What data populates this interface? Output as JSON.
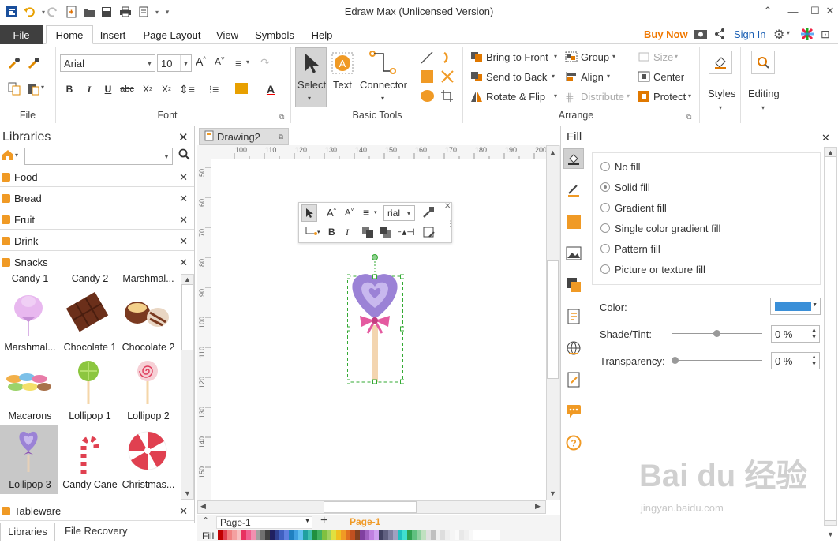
{
  "window": {
    "title": "Edraw Max (Unlicensed Version)"
  },
  "ribbon_tabs": {
    "file": "File",
    "home": "Home",
    "insert": "Insert",
    "page_layout": "Page Layout",
    "view": "View",
    "symbols": "Symbols",
    "help": "Help"
  },
  "account": {
    "buy_now": "Buy Now",
    "sign_in": "Sign In"
  },
  "font_group": {
    "font_name": "Arial",
    "font_size": "10",
    "label": "Font"
  },
  "file_group": {
    "label": "File"
  },
  "basic_tools": {
    "select": "Select",
    "text": "Text",
    "connector": "Connector",
    "label": "Basic Tools"
  },
  "arrange": {
    "bring_to_front": "Bring to Front",
    "send_to_back": "Send to Back",
    "rotate_flip": "Rotate & Flip",
    "group": "Group",
    "align": "Align",
    "distribute": "Distribute",
    "size": "Size",
    "center": "Center",
    "protect": "Protect",
    "label": "Arrange"
  },
  "styles": {
    "label": "Styles"
  },
  "editing": {
    "label": "Editing"
  },
  "libraries": {
    "title": "Libraries",
    "search_placeholder": "",
    "categories": [
      "Food",
      "Bread",
      "Fruit",
      "Drink",
      "Snacks"
    ],
    "tableware": "Tableware",
    "symbols": [
      {
        "label": "Candy 1"
      },
      {
        "label": "Candy 2"
      },
      {
        "label": "Marshmal..."
      },
      {
        "label": "Marshmal..."
      },
      {
        "label": "Chocolate 1"
      },
      {
        "label": "Chocolate 2"
      },
      {
        "label": "Macarons"
      },
      {
        "label": "Lollipop 1"
      },
      {
        "label": "Lollipop 2"
      },
      {
        "label": "Lollipop 3"
      },
      {
        "label": "Candy Cane"
      },
      {
        "label": "Christmas..."
      }
    ],
    "bottom_tabs": {
      "libraries": "Libraries",
      "file_recovery": "File Recovery"
    }
  },
  "document": {
    "tab": "Drawing2",
    "page_selector": "Page-1",
    "page_tab": "Page-1",
    "fill_label": "Fill"
  },
  "ruler": {
    "h": [
      "100",
      "110",
      "120",
      "130",
      "140",
      "150",
      "160",
      "170",
      "180",
      "190",
      "200"
    ],
    "v": [
      "50",
      "60",
      "70",
      "80",
      "90",
      "100",
      "110",
      "120",
      "130",
      "140",
      "150"
    ]
  },
  "float_toolbar": {
    "font": "rial"
  },
  "fill_panel": {
    "title": "Fill",
    "options": [
      "No fill",
      "Solid fill",
      "Gradient fill",
      "Single color gradient fill",
      "Pattern fill",
      "Picture or texture fill"
    ],
    "selected": 1,
    "color_label": "Color:",
    "color_value": "#3a8fd8",
    "shade_label": "Shade/Tint:",
    "shade_value": "0 %",
    "transparency_label": "Transparency:",
    "transparency_value": "0 %"
  },
  "watermark": {
    "brand": "Bai du 经验",
    "url": "jingyan.baidu.com"
  },
  "colors": {
    "accent": "#f09a25",
    "file_tab": "#3f3f3f",
    "link": "#1a5fb4"
  }
}
